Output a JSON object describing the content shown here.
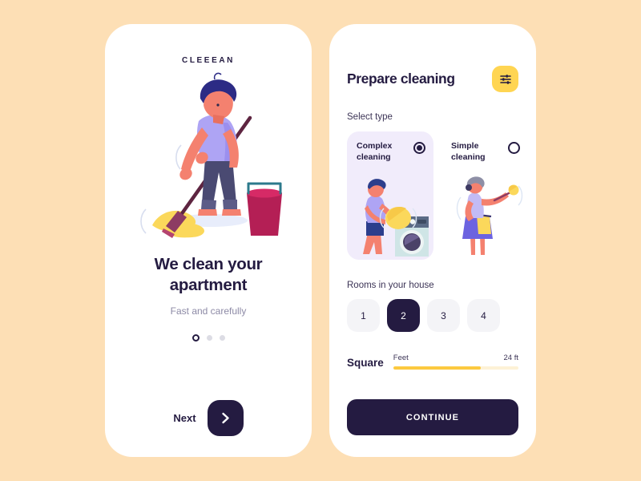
{
  "theme": {
    "background": "#FDDFB5",
    "card": "#FFFFFF",
    "navy": "#241B41",
    "yellow": "#FFD552",
    "slider_fill": "#FCC93F",
    "slider_track": "#FDF2D6",
    "selected_card": "#F1ECFB",
    "muted_text": "#8D8AA6",
    "room_button": "#F4F4F7"
  },
  "onboarding": {
    "brand": "CLEEEAN",
    "illustration_name": "person-mopping-floor-illustration",
    "headline": "We clean your apartment",
    "subheadline": "Fast and carefully",
    "pagination": {
      "total": 3,
      "active_index": 0
    },
    "next_label": "Next",
    "next_icon": "chevron-right-icon"
  },
  "prepare": {
    "title": "Prepare cleaning",
    "filter_icon": "sliders-filter-icon",
    "select_type_label": "Select type",
    "types": [
      {
        "label_line1": "Complex",
        "label_line2": "cleaning",
        "selected": true,
        "illustration_name": "man-with-laundry-basket-and-washing-machine-illustration"
      },
      {
        "label_line1": "Simple",
        "label_line2": "cleaning",
        "selected": false,
        "illustration_name": "woman-with-duster-illustration"
      }
    ],
    "rooms_label": "Rooms in your house",
    "rooms": [
      {
        "value": "1",
        "selected": false
      },
      {
        "value": "2",
        "selected": true
      },
      {
        "value": "3",
        "selected": false
      },
      {
        "value": "4",
        "selected": false
      }
    ],
    "square": {
      "label": "Square",
      "unit": "Feet",
      "value": "24 ft",
      "fill_percent": 70
    },
    "continue_label": "CONTINUE"
  }
}
